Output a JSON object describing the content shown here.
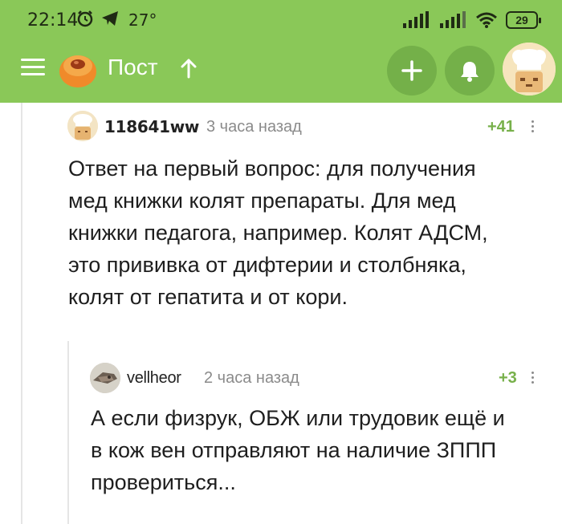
{
  "status_bar": {
    "time": "22:14",
    "temperature": "27°",
    "battery": "29"
  },
  "app_bar": {
    "title": "Пост"
  },
  "comments": [
    {
      "username": "118641ww",
      "time": "3 часа назад",
      "rating": "+41",
      "text_lines": [
        "Ответ на первый вопрос: для получения",
        "мед книжки колят препараты. Для мед",
        "книжки педагога, например. Колят АДСМ,",
        "это прививка от дифтерии и столбняка,",
        "колят от гепатита и от кори."
      ]
    },
    {
      "username": "vellheor",
      "time": "2 часа назад",
      "rating": "+3",
      "text_lines": [
        "А если физрук, ОБЖ или трудовик ещё и",
        "в кож вен отправляют на наличие ЗППП",
        "провериться..."
      ]
    }
  ],
  "colors": {
    "header": "#8ac858",
    "rating": "#77b04a"
  }
}
